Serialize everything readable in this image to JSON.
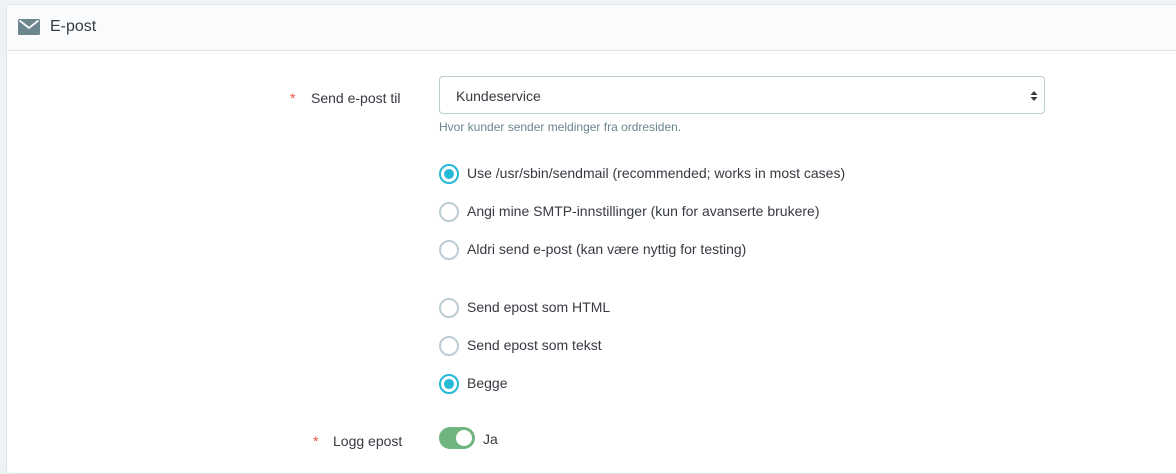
{
  "panel": {
    "title": "E-post",
    "icon": "envelope-icon"
  },
  "form": {
    "required_marker": "*",
    "send_to": {
      "label": "Send e-post til",
      "value": "Kundeservice",
      "help": "Hvor kunder sender meldinger fra ordresiden."
    },
    "mail_method": {
      "options": [
        {
          "label": "Use /usr/sbin/sendmail (recommended; works in most cases)",
          "checked": true
        },
        {
          "label": "Angi mine SMTP-innstillinger (kun for avanserte brukere)",
          "checked": false
        },
        {
          "label": "Aldri send e-post (kan være nyttig for testing)",
          "checked": false
        }
      ]
    },
    "mail_format": {
      "options": [
        {
          "label": "Send epost som HTML",
          "checked": false
        },
        {
          "label": "Send epost som tekst",
          "checked": false
        },
        {
          "label": "Begge",
          "checked": true
        }
      ]
    },
    "log_email": {
      "label": "Logg epost",
      "value_label": "Ja",
      "enabled": true
    }
  },
  "colors": {
    "accent": "#25b9d7",
    "switch_on": "#70b580",
    "required": "#e84f46"
  }
}
